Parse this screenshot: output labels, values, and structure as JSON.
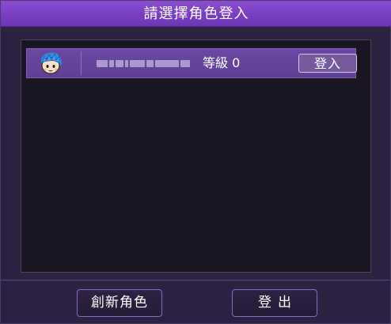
{
  "dialog": {
    "title": "請選擇角色登入"
  },
  "characters": [
    {
      "avatar_icon": "blue-haired-character-avatar-icon",
      "name": "",
      "level_text": "等級 0",
      "enter_label": "登入"
    }
  ],
  "footer": {
    "create_label": "創新角色",
    "logout_label": "登出"
  },
  "colors": {
    "titlebar": "#7a3fc3",
    "row": "#5f3f94",
    "panel": "#1a1522",
    "button_border": "#8a67c6"
  }
}
